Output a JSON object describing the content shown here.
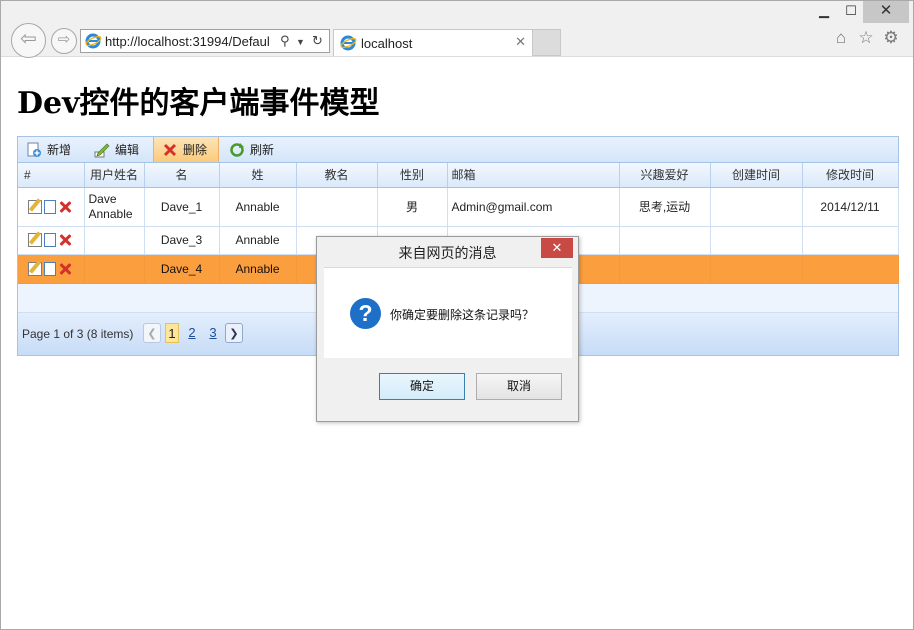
{
  "browser": {
    "url_visible": "http://localhost:31994/Defaul",
    "tab_title": "localhost"
  },
  "page": {
    "title": "Dev控件的客户端事件模型"
  },
  "toolbar": {
    "new_label": "新增",
    "edit_label": "编辑",
    "delete_label": "删除",
    "refresh_label": "刷新"
  },
  "grid": {
    "columns": [
      "#",
      "用户姓名",
      "名",
      "姓",
      "教名",
      "性别",
      "邮箱",
      "兴趣爱好",
      "创建时间",
      "修改时间"
    ],
    "rows": [
      {
        "user_name": "Dave Annable",
        "first": "Dave_1",
        "last": "Annable",
        "christian": "",
        "gender": "男",
        "email": "Admin@gmail.com",
        "hobby": "思考,运动",
        "created": "",
        "modified": "2014/12/11"
      },
      {
        "user_name": "",
        "first": "Dave_3",
        "last": "Annable",
        "christian": "",
        "gender": "",
        "email": "",
        "hobby": "",
        "created": "",
        "modified": ""
      },
      {
        "user_name": "",
        "first": "Dave_4",
        "last": "Annable",
        "christian": "",
        "gender": "",
        "email": "",
        "hobby": "",
        "created": "",
        "modified": ""
      }
    ]
  },
  "pager": {
    "summary": "Page 1 of 3 (8 items)",
    "pages": [
      "1",
      "2",
      "3"
    ],
    "current": "1"
  },
  "dialog": {
    "title": "来自网页的消息",
    "message": "你确定要删除这条记录吗？",
    "ok_label": "确定",
    "cancel_label": "取消"
  },
  "colors": {
    "selected_row": "#fb9e3e",
    "grid_border": "#a4c3e6",
    "dialog_close": "#c94a44",
    "question_icon": "#1d6fc8"
  }
}
